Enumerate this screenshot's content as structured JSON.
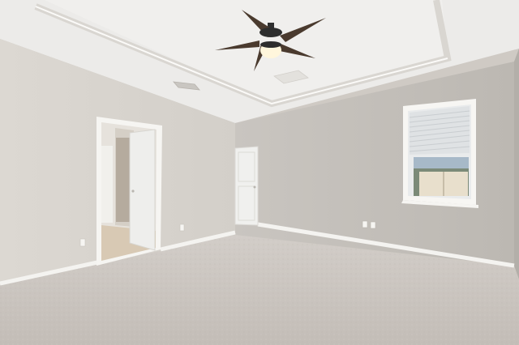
{
  "scene": {
    "description_name": "empty-bedroom-photo"
  },
  "colors": {
    "ceiling": "#ecebe9",
    "ceiling_shadow": "#dcdad6",
    "wall_left": "#dad6d0",
    "wall_back": "#c7c3be",
    "wall_right": "#bfbbb5",
    "carpet": "#c9c4bf",
    "baseboard": "#f3f2ef",
    "door": "#eeeeec",
    "fan_blade": "#4a3a2e",
    "fan_light": "#fff6dc"
  },
  "icons": {
    "ceiling_fan": "ceiling-fan-icon",
    "window": "window-icon",
    "door": "door-icon",
    "outlet": "outlet-icon",
    "vent": "vent-icon"
  }
}
